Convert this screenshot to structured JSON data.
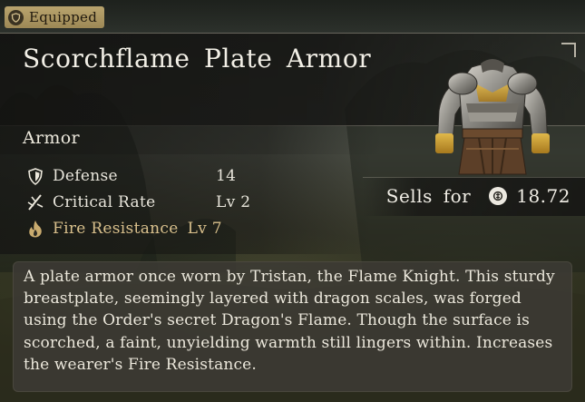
{
  "status_tag": {
    "label": "Equipped",
    "icon": "shield-badge-icon"
  },
  "item": {
    "name": "Scorchflame Plate Armor",
    "type": "Armor",
    "image_icon": "plate-armor-icon"
  },
  "stats": [
    {
      "icon": "shield-icon",
      "label": "Defense",
      "value": "14"
    },
    {
      "icon": "slash-icon",
      "label": "Critical Rate",
      "value": "Lv 2"
    }
  ],
  "bonus": {
    "icon": "flame-icon",
    "label": "Fire Resistance",
    "value": "Lv 7"
  },
  "sale": {
    "label": "Sells for",
    "currency_icon": "coin-icon",
    "price": "18.72"
  },
  "description": "A plate armor once worn by Tristan, the Flame Knight. This sturdy breastplate, seemingly layered with dragon scales, was forged using the Order's secret Dragon's Flame. Though the surface is scorched, a faint, unyielding warmth still lingers within. Increases the wearer's Fire Resistance.",
  "colors": {
    "tag_gold": "#b9a46e",
    "bonus_text": "#d9c08c",
    "text": "#ece8dc",
    "panel": "#3c3a34"
  }
}
